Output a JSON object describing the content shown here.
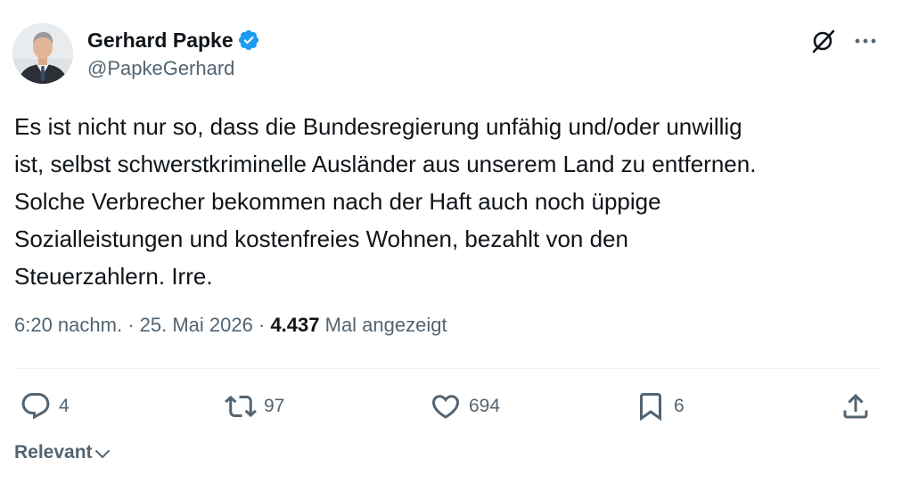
{
  "author": {
    "display_name": "Gerhard Papke",
    "handle": "@PapkeGerhard",
    "verified": true
  },
  "tweet": {
    "lines": [
      "Es ist nicht nur so, dass die Bundesregierung unfähig und/oder unwillig",
      "ist, selbst schwerstkriminelle Ausländer aus unserem Land zu entfernen.",
      "Solche Verbrecher bekommen nach der Haft auch noch üppige",
      "Sozialleistungen und kostenfreies Wohnen, bezahlt von den",
      "Steuerzahlern. Irre."
    ],
    "time": "6:20 nachm.",
    "separator": "·",
    "date": "25. Mai 2026",
    "views": "4.437",
    "views_label": "Mal angezeigt"
  },
  "actions": {
    "replies": "4",
    "reposts": "97",
    "likes": "694",
    "bookmarks": "6"
  },
  "sort": {
    "label": "Relevant"
  },
  "icons": {
    "verified": "verified-badge-icon",
    "grok": "grok-icon",
    "more": "more-icon",
    "reply": "reply-icon",
    "repost": "repost-icon",
    "like": "heart-icon",
    "bookmark": "bookmark-icon",
    "share": "share-icon",
    "chevron": "chevron-down-icon"
  },
  "colors": {
    "text": "#0f1419",
    "secondary": "#536471",
    "verified": "#1d9bf0",
    "divider": "#eff3f4"
  }
}
